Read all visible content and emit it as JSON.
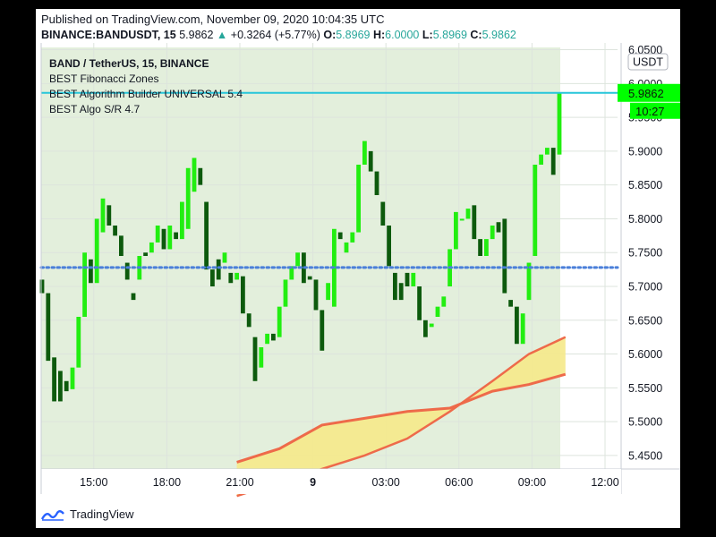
{
  "header": {
    "published_line": "Published on TradingView.com, November 09, 2020 10:04:35 UTC",
    "symbol": "BINANCE:BANDUSDT, 15",
    "last_price": "5.9862",
    "change_arrow": "▲",
    "change": "+0.3264 (+5.77%)",
    "o_label": "O:",
    "o_value": "5.8969",
    "h_label": "H:",
    "h_value": "6.0000",
    "l_label": "L:",
    "l_value": "5.8969",
    "c_label": "C:",
    "c_value": "5.9862"
  },
  "legend": {
    "title": "BAND / TetherUS, 15, BINANCE",
    "indicator_1": "BEST Fibonacci Zones",
    "indicator_2": "BEST Algorithm Builder UNIVERSAL 5.4",
    "indicator_3": "BEST Algo S/R 4.7"
  },
  "price_axis": {
    "currency": "USDT",
    "current_price": "5.9862",
    "countdown": "10:27"
  },
  "branding": {
    "name": "TradingView"
  },
  "colors": {
    "background_zone": "#e3efdc",
    "bull": "#22ee11",
    "bear": "#0d5a0d",
    "sr_line": "#4a7fd9",
    "price_line": "#26c6da",
    "fib_fill": "#f5e98a",
    "fib_line": "#ee6a4a",
    "price_label_bg": "#00ff00"
  },
  "chart_data": {
    "type": "candlestick",
    "ylim": [
      5.43,
      6.06
    ],
    "yticks": [
      "5.4500",
      "5.5000",
      "5.5500",
      "5.6000",
      "5.6500",
      "5.7000",
      "5.7500",
      "5.8000",
      "5.8500",
      "5.9000",
      "5.9500",
      "6.0000",
      "6.0500"
    ],
    "xticks": [
      {
        "i": 8.5,
        "label": "15:00"
      },
      {
        "i": 20.5,
        "label": "18:00"
      },
      {
        "i": 32.5,
        "label": "21:00"
      },
      {
        "i": 44.5,
        "label": "9"
      },
      {
        "i": 56.5,
        "label": "03:00"
      },
      {
        "i": 68.5,
        "label": "06:00"
      },
      {
        "i": 80.5,
        "label": "09:00"
      },
      {
        "i": 92.5,
        "label": "12:00"
      }
    ],
    "support_resistance": 5.728,
    "current_price": 5.9862,
    "candles": [
      [
        5.71,
        5.69
      ],
      [
        5.69,
        5.59
      ],
      [
        5.595,
        5.53
      ],
      [
        5.575,
        5.53
      ],
      [
        5.56,
        5.545
      ],
      [
        5.548,
        5.58
      ],
      [
        5.58,
        5.655
      ],
      [
        5.655,
        5.75
      ],
      [
        5.74,
        5.705
      ],
      [
        5.705,
        5.8
      ],
      [
        5.78,
        5.83
      ],
      [
        5.82,
        5.79
      ],
      [
        5.79,
        5.775
      ],
      [
        5.775,
        5.745
      ],
      [
        5.735,
        5.71
      ],
      [
        5.69,
        5.68
      ],
      [
        5.71,
        5.745
      ],
      [
        5.75,
        5.745
      ],
      [
        5.75,
        5.765
      ],
      [
        5.765,
        5.79
      ],
      [
        5.785,
        5.755
      ],
      [
        5.755,
        5.79
      ],
      [
        5.78,
        5.77
      ],
      [
        5.77,
        5.825
      ],
      [
        5.785,
        5.875
      ],
      [
        5.84,
        5.89
      ],
      [
        5.875,
        5.85
      ],
      [
        5.825,
        5.725
      ],
      [
        5.725,
        5.7
      ],
      [
        5.74,
        5.71
      ],
      [
        5.735,
        5.75
      ],
      [
        5.72,
        5.705
      ],
      [
        5.71,
        5.72
      ],
      [
        5.715,
        5.66
      ],
      [
        5.66,
        5.64
      ],
      [
        5.625,
        5.56
      ],
      [
        5.58,
        5.61
      ],
      [
        5.615,
        5.63
      ],
      [
        5.63,
        5.62
      ],
      [
        5.625,
        5.67
      ],
      [
        5.67,
        5.71
      ],
      [
        5.71,
        5.73
      ],
      [
        5.73,
        5.75
      ],
      [
        5.75,
        5.705
      ],
      [
        5.715,
        5.71
      ],
      [
        5.71,
        5.665
      ],
      [
        5.665,
        5.605
      ],
      [
        5.68,
        5.705
      ],
      [
        5.67,
        5.785
      ],
      [
        5.78,
        5.77
      ],
      [
        5.75,
        5.765
      ],
      [
        5.765,
        5.78
      ],
      [
        5.78,
        5.88
      ],
      [
        5.88,
        5.915
      ],
      [
        5.9,
        5.87
      ],
      [
        5.87,
        5.835
      ],
      [
        5.825,
        5.79
      ],
      [
        5.79,
        5.73
      ],
      [
        5.72,
        5.68
      ],
      [
        5.705,
        5.68
      ],
      [
        5.72,
        5.7
      ],
      [
        5.7,
        5.72
      ],
      [
        5.7,
        5.65
      ],
      [
        5.65,
        5.625
      ],
      [
        5.64,
        5.645
      ],
      [
        5.655,
        5.67
      ],
      [
        5.67,
        5.685
      ],
      [
        5.7,
        5.755
      ],
      [
        5.755,
        5.81
      ],
      [
        5.8,
        5.8
      ],
      [
        5.8,
        5.815
      ],
      [
        5.82,
        5.77
      ],
      [
        5.77,
        5.745
      ],
      [
        5.745,
        5.77
      ],
      [
        5.77,
        5.79
      ],
      [
        5.795,
        5.78
      ],
      [
        5.8,
        5.69
      ],
      [
        5.68,
        5.67
      ],
      [
        5.67,
        5.615
      ],
      [
        5.615,
        5.66
      ],
      [
        5.68,
        5.735
      ],
      [
        5.745,
        5.88
      ],
      [
        5.88,
        5.895
      ],
      [
        5.895,
        5.905
      ],
      [
        5.905,
        5.865
      ],
      [
        5.895,
        5.986
      ]
    ],
    "fib_upper": [
      [
        32,
        5.44
      ],
      [
        39,
        5.46
      ],
      [
        46,
        5.495
      ],
      [
        53,
        5.505
      ],
      [
        60,
        5.515
      ],
      [
        67,
        5.52
      ],
      [
        74,
        5.545
      ],
      [
        80,
        5.555
      ],
      [
        86,
        5.57
      ]
    ],
    "fib_lower": [
      [
        32,
        5.39
      ],
      [
        39,
        5.41
      ],
      [
        46,
        5.43
      ],
      [
        53,
        5.45
      ],
      [
        60,
        5.475
      ],
      [
        67,
        5.515
      ],
      [
        74,
        5.56
      ],
      [
        80,
        5.6
      ],
      [
        86,
        5.625
      ]
    ]
  }
}
